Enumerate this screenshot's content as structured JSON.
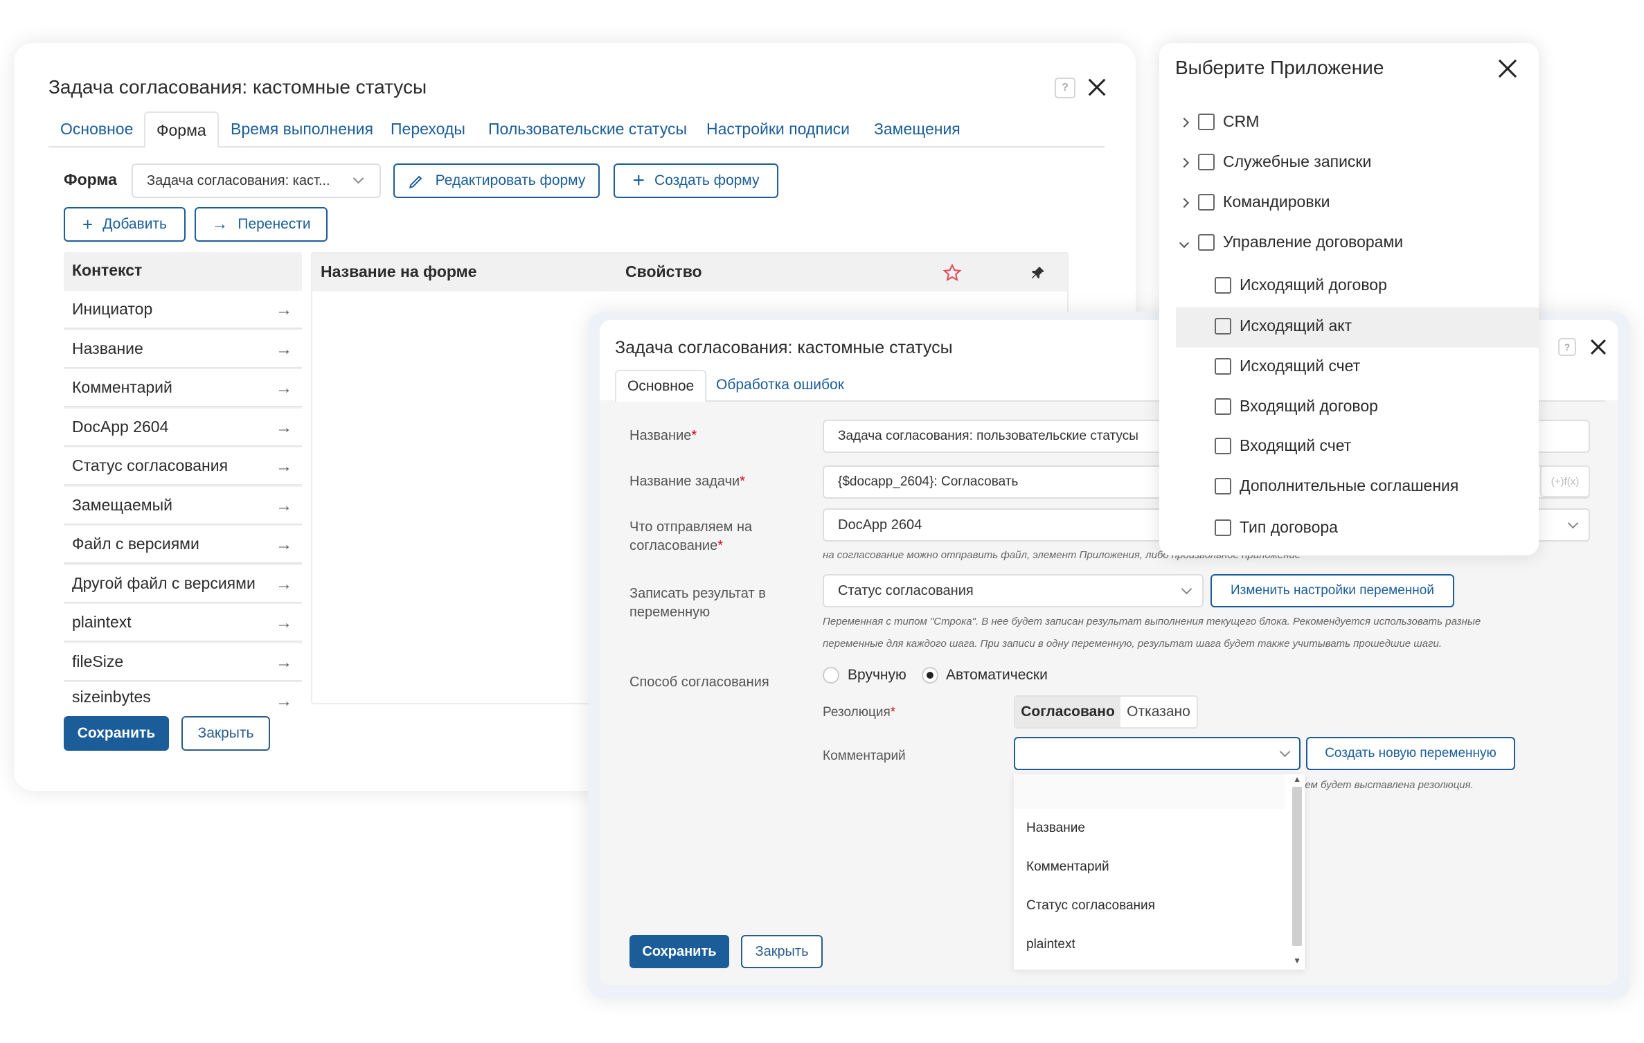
{
  "left_dialog": {
    "title": "Задача согласования: кастомные статусы",
    "help": "?",
    "tabs": [
      "Основное",
      "Форма",
      "Время выполнения",
      "Переходы",
      "Пользовательские статусы",
      "Настройки подписи",
      "Замещения"
    ],
    "active_tab": "Форма",
    "form_label": "Форма",
    "form_select_value": "Задача согласования: каст...",
    "edit_form_label": "Редактировать форму",
    "create_form_label": "Создать форму",
    "add_label": "Добавить",
    "move_label": "Перенести",
    "context_header": "Контекст",
    "context_items": [
      "Инициатор",
      "Название",
      "Комментарий",
      "DocApp 2604",
      "Статус согласования",
      "Замещаемый",
      "Файл с версиями",
      "Другой файл с версиями",
      "plaintext",
      "fileSize",
      "sizeinbytes"
    ],
    "col_name_on_form": "Название на форме",
    "col_property": "Свойство",
    "save_label": "Сохранить",
    "close_label": "Закрыть"
  },
  "app_picker": {
    "title": "Выберите Приложение",
    "items": [
      {
        "label": "CRM",
        "icon": "crm-icon",
        "level": 0,
        "expand": "collapsed"
      },
      {
        "label": "Служебные записки",
        "icon": "copy-icon",
        "level": 0,
        "expand": "collapsed"
      },
      {
        "label": "Командировки",
        "icon": "plane-icon",
        "level": 0,
        "expand": "collapsed"
      },
      {
        "label": "Управление договорами",
        "icon": "briefcase-icon",
        "level": 0,
        "expand": "expanded"
      },
      {
        "label": "Исходящий договор",
        "icon": "briefcase-icon",
        "level": 1
      },
      {
        "label": "Исходящий акт",
        "icon": "document-icon",
        "level": 1,
        "selected": true
      },
      {
        "label": "Исходящий счет",
        "icon": "coins-icon",
        "level": 1
      },
      {
        "label": "Входящий договор",
        "icon": "document-icon",
        "level": 1
      },
      {
        "label": "Входящий счет",
        "icon": "hand-coins-icon",
        "level": 1
      },
      {
        "label": "Дополнительные соглашения",
        "icon": "clipboard-icon",
        "level": 1
      },
      {
        "label": "Тип договора",
        "icon": "hierarchy-icon",
        "level": 1
      }
    ]
  },
  "right_dialog": {
    "title": "Задача согласования: кастомные статусы",
    "help": "?",
    "tabs": [
      "Основное",
      "Обработка ошибок"
    ],
    "active_tab": "Основное",
    "name_label": "Название",
    "name_value": "Задача согласования: пользовательские статусы",
    "task_name_label": "Название задачи",
    "task_name_value": "{$docapp_2604}: Согласовать",
    "formula_badge": "(+)f(x)",
    "send_label_1": "Что отправляем на",
    "send_label_2": "согласование",
    "send_value": "DocApp 2604",
    "send_hint": "на согласование можно отправить файл, элемент Приложения, либо произвольное приложение",
    "result_label_1": "Записать результат в",
    "result_label_2": "переменную",
    "result_value": "Статус согласования",
    "change_var_label": "Изменить настройки переменной",
    "result_hint_1": "Переменная с типом \"Строка\". В нее будет записан результат выполнения текущего блока. Рекомендуется использовать разные",
    "result_hint_2": "переменные для каждого шага. При записи в одну переменную, результат шага будет также учитывать прошедшие шаги.",
    "method_label": "Способ согласования",
    "method_manual": "Вручную",
    "method_auto": "Автоматически",
    "method_selected": "Автоматически",
    "resolution_label": "Резолюция",
    "resolution_approved": "Согласовано",
    "resolution_rejected": "Отказано",
    "comment_label": "Комментарий",
    "comment_value": "",
    "create_var_label": "Создать новую переменную",
    "comment_hint": "ием будет выставлена резолюция.",
    "dropdown_options": [
      "Название",
      "Комментарий",
      "Статус согласования",
      "plaintext"
    ],
    "save_label": "Сохранить",
    "close_label": "Закрыть"
  },
  "colors": {
    "primary": "#1a5d98",
    "link": "#1a5d98",
    "required": "#d0021b",
    "header_bg": "#f1f1f1",
    "selected_bg": "#efefef",
    "star": "#e14c5a"
  }
}
